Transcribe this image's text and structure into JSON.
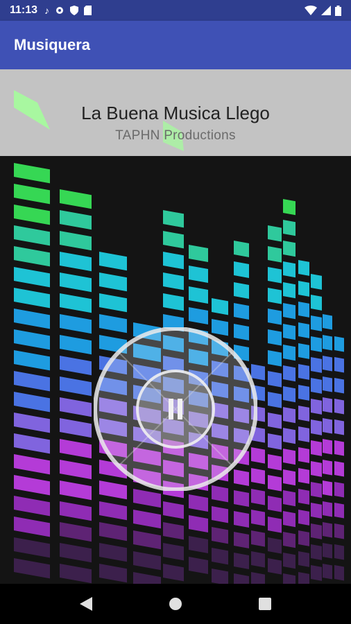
{
  "status_bar": {
    "time": "11:13",
    "left_icons": [
      "music-note-icon",
      "gear-icon",
      "shield-icon",
      "sd-card-icon"
    ],
    "right_icons": [
      "wifi-icon",
      "signal-icon",
      "battery-icon"
    ]
  },
  "app_bar": {
    "title": "Musiquera"
  },
  "now_playing": {
    "title": "La Buena Musica Llego",
    "artist": "TAPHN Productions"
  },
  "player": {
    "state": "playing",
    "control_icon": "pause-icon"
  },
  "nav_bar": {
    "buttons": [
      "back-icon",
      "home-icon",
      "recents-icon"
    ]
  },
  "colors": {
    "status_bar": "#2f3e8f",
    "app_bar": "#3f51b5",
    "now_playing_bg": "#c3c3c3"
  }
}
